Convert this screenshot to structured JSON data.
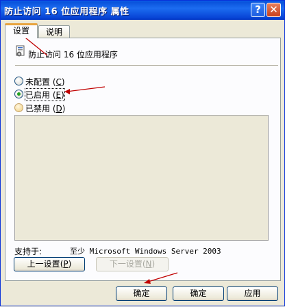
{
  "window": {
    "title": "防止访问 16 位应用程序 属性",
    "help_label": "?",
    "close_label": "✕"
  },
  "tabs": [
    {
      "label": "设置"
    },
    {
      "label": "说明"
    }
  ],
  "policy": {
    "title": "防止访问 16 位应用程序",
    "icon": "policy-setting-icon"
  },
  "options": [
    {
      "label": "未配置",
      "accel": "C"
    },
    {
      "label": "已启用",
      "accel": "E"
    },
    {
      "label": "已禁用",
      "accel": "D"
    }
  ],
  "supported": {
    "label": "支持于:",
    "value": "至少 Microsoft Windows Server 2003"
  },
  "nav": {
    "prev_label": "上一设置",
    "prev_accel": "P",
    "next_label": "下一设置",
    "next_accel": "N"
  },
  "footer": {
    "ok_label": "确定",
    "ok2_label": "确定",
    "apply_label": "应用"
  },
  "colors": {
    "titlebar": "#0a5ee8",
    "active_tab_accent": "#e8a33c",
    "annotation_arrow": "#c00000"
  }
}
